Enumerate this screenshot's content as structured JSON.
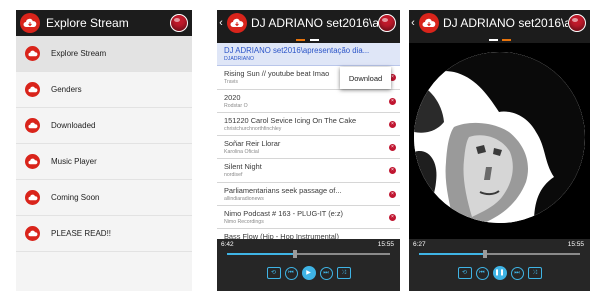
{
  "drawer": {
    "title": "Explore Stream",
    "items": [
      {
        "label": "Explore Stream"
      },
      {
        "label": "Genders"
      },
      {
        "label": "Downloaded"
      },
      {
        "label": "Music Player"
      },
      {
        "label": "Coming Soon"
      },
      {
        "label": "PLEASE READ!!"
      }
    ]
  },
  "list_screen": {
    "back": "‹",
    "title": "DJ ADRIANO set2016\\apresentação dia...",
    "popup_label": "Download",
    "tracks": [
      {
        "title": "DJ ADRIANO set2016\\apresentação dia...",
        "artist": "DJADRIANO"
      },
      {
        "title": "Rising Sun // youtube beat Imao",
        "artist": "Travis"
      },
      {
        "title": "2020",
        "artist": "Rodstar O"
      },
      {
        "title": "151220 Carol Sevice Icing On The Cake",
        "artist": "christchurchnorthfinchley"
      },
      {
        "title": "Soñar Reir Llorar",
        "artist": "Karolina Oficial"
      },
      {
        "title": "Silent Night",
        "artist": "nordisef"
      },
      {
        "title": "Parliamentarians seek passage of...",
        "artist": "allindiaradionews"
      },
      {
        "title": "Nimo Podcast # 163 - PLUG-IT (e:z)",
        "artist": "Nimo Recordings"
      },
      {
        "title": "Bass Flow (Hip - Hop Instrumental)",
        "artist": ""
      }
    ],
    "remove_symbol": "×",
    "player": {
      "elapsed": "6:42",
      "total": "15:55",
      "progress": 0.42
    }
  },
  "art_screen": {
    "back": "‹",
    "title": "DJ ADRIANO set2016\\apresentação dia...",
    "player": {
      "elapsed": "6:27",
      "total": "15:55",
      "progress": 0.41
    }
  },
  "controls": {
    "repeat": "⟲",
    "prev": "⏮",
    "play": "▶",
    "pause": "❚❚",
    "next": "⏭",
    "shuffle": "⤨"
  },
  "colors": {
    "brand": "#d9241b",
    "accent": "#3fb4e5",
    "tab_active": "#e8740c",
    "bar": "#1c1c1c"
  },
  "icons": [
    "cloud-download-icon",
    "red-ball-icon",
    "remove-icon",
    "repeat-icon",
    "previous-icon",
    "play-icon",
    "pause-icon",
    "next-icon",
    "shuffle-icon"
  ]
}
